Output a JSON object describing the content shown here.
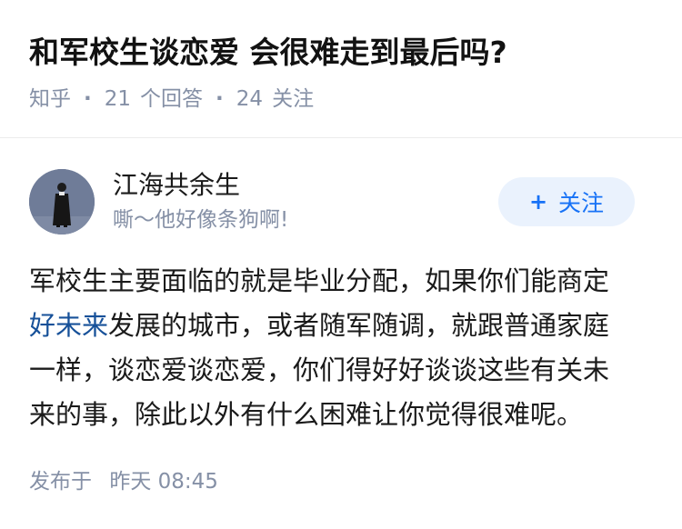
{
  "question": {
    "title": "和军校生谈恋爱 会很难走到最后吗?",
    "source": "知乎",
    "answer_count": "21",
    "answer_label": "个回答",
    "follower_count": "24",
    "follower_label": "关注"
  },
  "author": {
    "name": "江海共余生",
    "bio": "嘶～他好像条狗啊!",
    "follow_label": "关注",
    "avatar_icon": "person-silhouette-icon"
  },
  "answer": {
    "line1": "军校生主要面临的就是毕业分配，如果你们能商定",
    "link_text": "好未来",
    "line2_rest": "发展的城市，或者随军随调，就跟普通家庭",
    "line3": "一样，谈恋爱谈恋爱，你们得好好谈谈这些有关未",
    "line4": "来的事，除此以外有什么困难让你觉得很难呢。"
  },
  "footer": {
    "published_label": "发布于",
    "published_day": "昨天",
    "published_time": "08:45"
  },
  "colors": {
    "accent": "#1772f6",
    "link": "#175199",
    "muted": "#8590a6",
    "button_bg": "#eaf2fd",
    "avatar_bg": "#6f7c98"
  }
}
